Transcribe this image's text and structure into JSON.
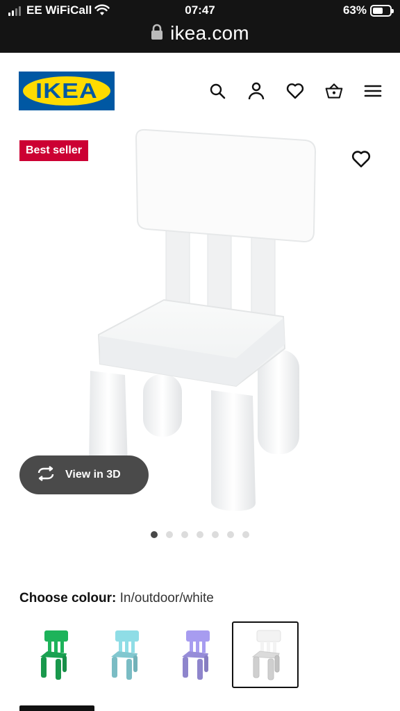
{
  "status": {
    "carrier": "EE WiFiCall",
    "time": "07:47",
    "battery": "63%",
    "battery_level": 0.63
  },
  "browser": {
    "url": "ikea.com"
  },
  "header": {
    "logo_text": "IKEA",
    "icons": [
      "search-icon",
      "account-icon",
      "heart-icon",
      "basket-icon",
      "menu-icon"
    ]
  },
  "product": {
    "badge": "Best seller",
    "view3d_label": "View in 3D",
    "carousel": {
      "count": 7,
      "active_index": 0
    }
  },
  "colour": {
    "label": "Choose colour:",
    "selected": "In/outdoor/white",
    "options": [
      {
        "name": "green",
        "color": "#1db35a",
        "selected": false
      },
      {
        "name": "turquoise",
        "color": "#8fdde6",
        "selected": false
      },
      {
        "name": "lilac",
        "color": "#a79cf0",
        "selected": false
      },
      {
        "name": "white",
        "color": "#f3f3f3",
        "selected": true
      }
    ]
  },
  "colors": {
    "brand_blue": "#0058a3",
    "brand_yellow": "#ffdb00",
    "badge_red": "#cc0033"
  }
}
